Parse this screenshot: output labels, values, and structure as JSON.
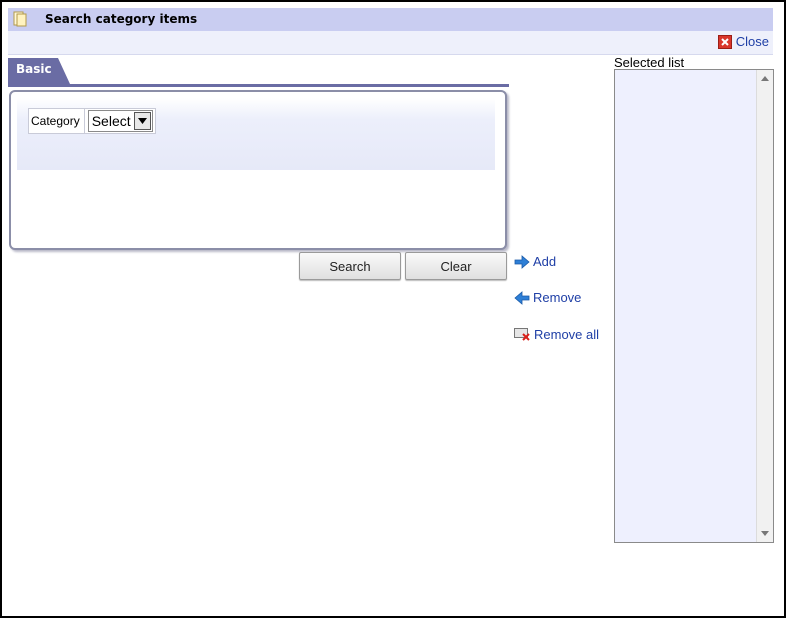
{
  "window": {
    "title": "Search category items",
    "title_icon": "document-icon",
    "close_label": "Close"
  },
  "tabs": [
    {
      "label": "Basic",
      "active": true
    }
  ],
  "search_form": {
    "category_label": "Category",
    "category_value": "Select"
  },
  "buttons": {
    "search_label": "Search",
    "clear_label": "Clear"
  },
  "actions": {
    "add_label": "Add",
    "remove_label": "Remove",
    "remove_all_label": "Remove all"
  },
  "selected_list": {
    "label": "Selected list",
    "items": []
  },
  "colors": {
    "title_bar": "#c9cdf1",
    "tab": "#6a6ca4",
    "link": "#1f3fa6",
    "list_bg": "#eef0fe"
  }
}
